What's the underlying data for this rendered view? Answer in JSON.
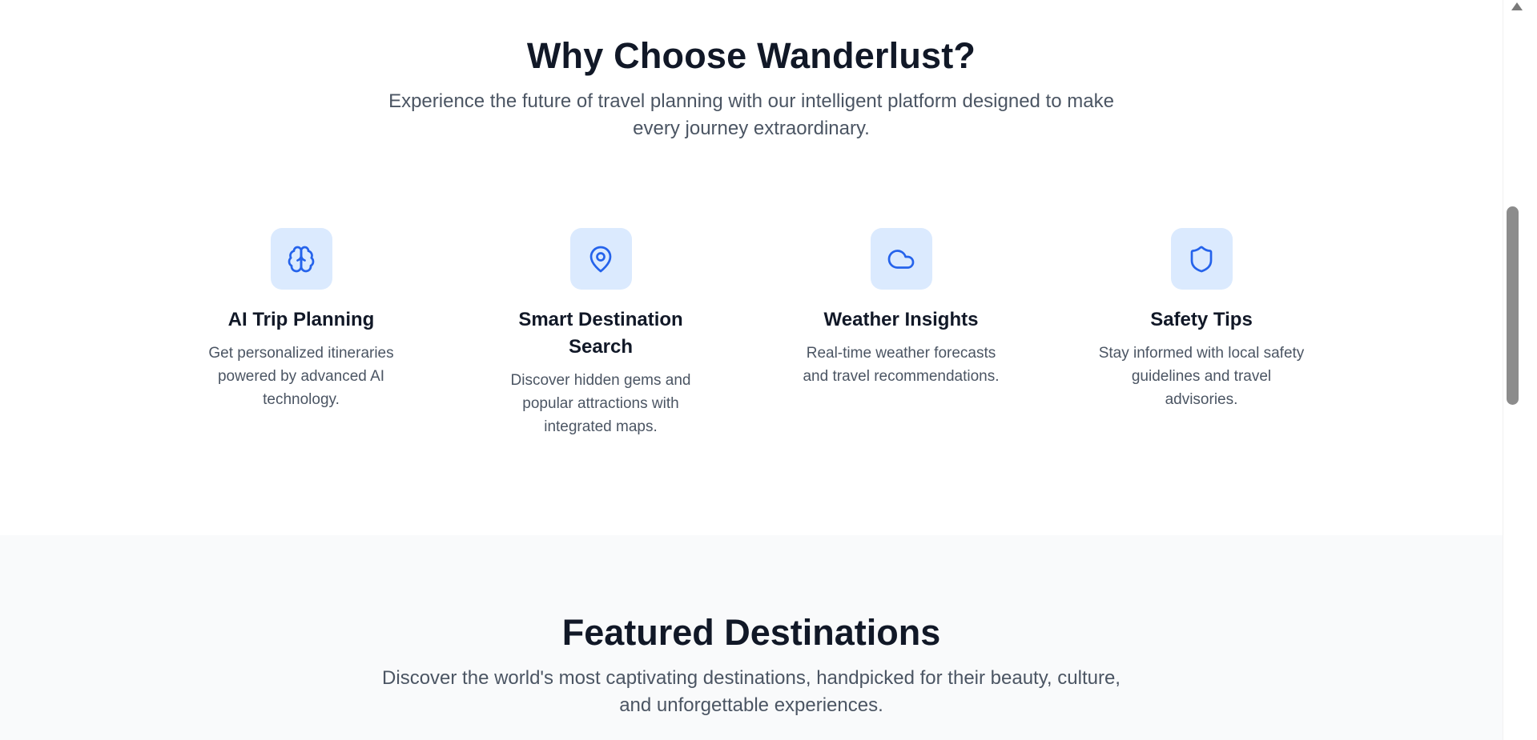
{
  "why": {
    "title": "Why Choose Wanderlust?",
    "subtitle": "Experience the future of travel planning with our intelligent platform designed to make every journey extraordinary.",
    "features": [
      {
        "icon": "brain-icon",
        "title": "AI Trip Planning",
        "description": "Get personalized itineraries powered by advanced AI technology."
      },
      {
        "icon": "map-pin-icon",
        "title": "Smart Destination Search",
        "description": "Discover hidden gems and popular attractions with integrated maps."
      },
      {
        "icon": "cloud-icon",
        "title": "Weather Insights",
        "description": "Real-time weather forecasts and travel recommendations."
      },
      {
        "icon": "shield-icon",
        "title": "Safety Tips",
        "description": "Stay informed with local safety guidelines and travel advisories."
      }
    ]
  },
  "featured": {
    "title": "Featured Destinations",
    "subtitle": "Discover the world's most captivating destinations, handpicked for their beauty, culture, and unforgettable experiences."
  },
  "colors": {
    "accent": "#2563eb",
    "icon_bg": "#dbeafe",
    "heading": "#111827",
    "body_text": "#4b5563",
    "section_alt_bg": "#f9fafb"
  }
}
